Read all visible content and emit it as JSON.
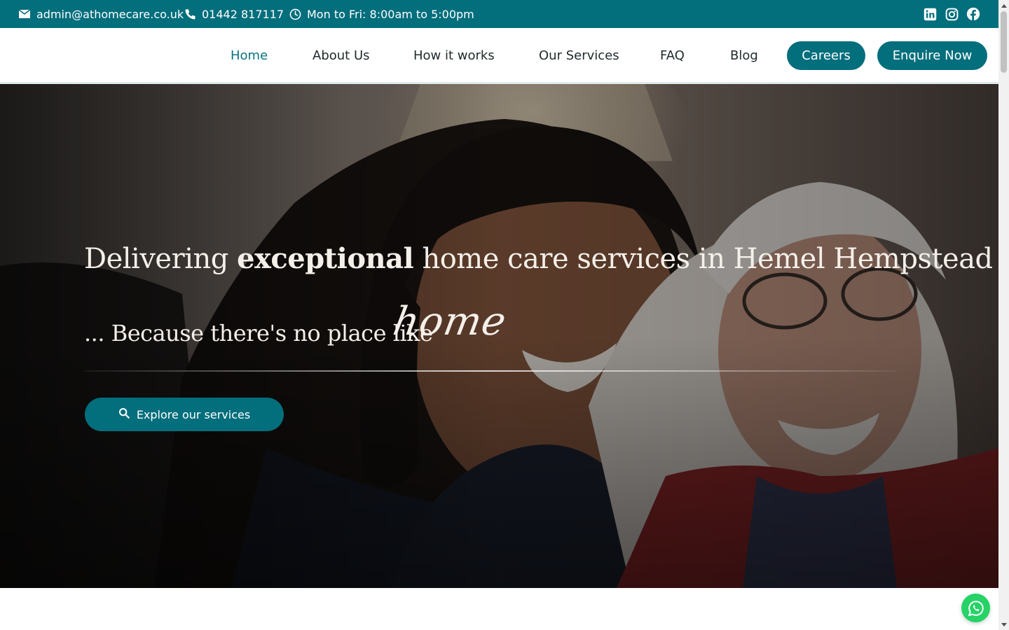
{
  "topbar": {
    "email": "admin@athomecare.co.uk",
    "phone": "01442 817117",
    "hours": "Mon to Fri: 8:00am to 5:00pm",
    "social": [
      "linkedin-icon",
      "instagram-icon",
      "facebook-icon"
    ],
    "bg_color": "#036e7c"
  },
  "nav": {
    "items": [
      {
        "label": "Home",
        "active": true
      },
      {
        "label": "About Us"
      },
      {
        "label": "How it works"
      },
      {
        "label": "Our Services"
      },
      {
        "label": "FAQ"
      },
      {
        "label": "Blog"
      }
    ],
    "careers_label": "Careers",
    "enquire_label": "Enquire Now",
    "active_color": "#0a7380",
    "button_color": "#036e7c"
  },
  "hero": {
    "title_pre": "Delivering",
    "title_bold": "exceptional",
    "title_post": "home care services in Hemel Hempstead",
    "subtitle": "... Because there's no place like",
    "subtitle_script": "home",
    "cta_label": "Explore our services",
    "cta_icon": "search-icon"
  },
  "floating": {
    "whatsapp_icon": "whatsapp-icon",
    "whatsapp_color": "#25d366"
  }
}
